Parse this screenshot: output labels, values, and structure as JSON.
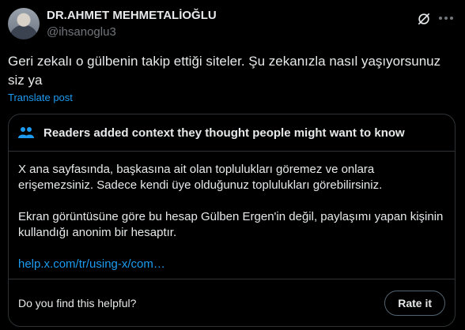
{
  "author": {
    "name": "DR.AHMET MEHMETALİOĞLU",
    "handle": "@ihsanoglu3"
  },
  "post": {
    "text": "Geri zekalı o gülbenin takip ettiği siteler. Şu zekanızla nasıl yaşıyorsunuz siz ya",
    "translate_label": "Translate post"
  },
  "community_note": {
    "title": "Readers added context they thought people might want to know",
    "paragraph_1": "X ana sayfasında, başkasına ait olan toplulukları göremez ve onlara erişemezsiniz. Sadece kendi üye olduğunuz toplulukları görebilirsiniz.",
    "paragraph_2": "Ekran görüntüsüne göre bu hesap Gülben Ergen'in değil, paylaşımı yapan kişinin kullandığı anonim bir hesaptır.",
    "link_text": "help.x.com/tr/using-x/com…",
    "helpful_question": "Do you find this helpful?",
    "rate_label": "Rate it"
  },
  "icons": {
    "header": [
      "avatar",
      "grok-icon",
      "more-icon"
    ],
    "note": "people-icon"
  },
  "colors": {
    "background": "#000000",
    "text": "#e7e9ea",
    "muted": "#71767b",
    "accent": "#1d9bf0",
    "border": "#2f3336"
  }
}
